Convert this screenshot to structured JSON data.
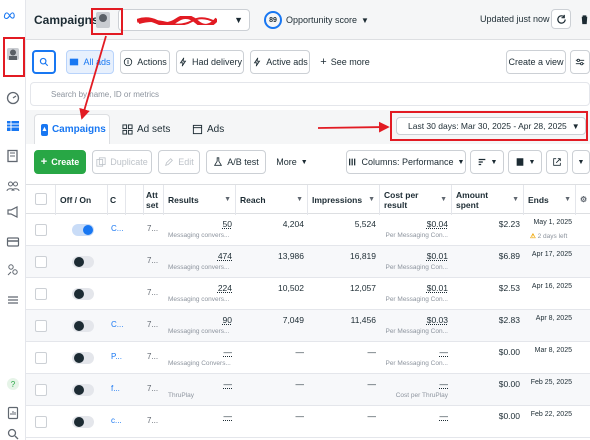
{
  "app": {
    "title": "Campaigns"
  },
  "colors": {
    "accent": "#1877f2",
    "create": "#28a745",
    "annotation": "#e21b23",
    "warning": "#f0a500"
  },
  "rail_icons": [
    "meta-logo-icon",
    "account-avatar-icon",
    "speedometer-icon",
    "table-grid-icon",
    "pages-icon",
    "people-icon",
    "megaphone-icon",
    "billing-card-icon",
    "audience-icon",
    "menu-icon",
    "help-icon",
    "report-icon",
    "search-icon"
  ],
  "header": {
    "opportunity_score": "89",
    "opportunity_label": "Opportunity score",
    "updated_text": "Updated just now"
  },
  "filters": {
    "all_ads": "All ads",
    "actions": "Actions",
    "had_delivery": "Had delivery",
    "active_ads": "Active ads",
    "see_more": "See more",
    "create_view": "Create a view"
  },
  "search": {
    "placeholder": "Search by name, ID or metrics"
  },
  "tabs": [
    {
      "label": "Campaigns"
    },
    {
      "label": "Ad sets"
    },
    {
      "label": "Ads"
    }
  ],
  "date_range": "Last 30 days: Mar 30, 2025 - Apr 28, 2025",
  "toolbar": {
    "create": "Create",
    "duplicate": "Duplicate",
    "edit": "Edit",
    "ab_test": "A/B test",
    "more": "More",
    "columns": "Columns: Performance"
  },
  "table": {
    "headers": {
      "onoff": "Off / On",
      "c": "C",
      "att1": "Att",
      "att2": "set",
      "results": "Results",
      "reach": "Reach",
      "impressions": "Impressions",
      "cost1": "Cost per",
      "cost2": "result",
      "amount": "Amount spent",
      "ends": "Ends"
    },
    "rows": [
      {
        "on": true,
        "name": "C...",
        "col3": "7...",
        "results": "50",
        "results_sub": "Messaging convers...",
        "reach": "4,204",
        "impressions": "5,524",
        "cost": "$0.04",
        "cost_sub": "Per Messaging Con...",
        "amount": "$2.23",
        "ends": "May 1, 2025",
        "ends_sub": "2 days left"
      },
      {
        "on": false,
        "name": "",
        "col3": "7...",
        "results": "474",
        "results_sub": "Messaging convers...",
        "reach": "13,986",
        "impressions": "16,819",
        "cost": "$0.01",
        "cost_sub": "Per Messaging Con...",
        "amount": "$6.89",
        "ends": "Apr 17, 2025",
        "ends_sub": ""
      },
      {
        "on": false,
        "name": "",
        "col3": "7...",
        "results": "224",
        "results_sub": "Messaging convers...",
        "reach": "10,502",
        "impressions": "12,057",
        "cost": "$0.01",
        "cost_sub": "Per Messaging Con...",
        "amount": "$2.53",
        "ends": "Apr 16, 2025",
        "ends_sub": ""
      },
      {
        "on": false,
        "name": "C...",
        "col3": "7...",
        "results": "90",
        "results_sub": "Messaging convers...",
        "reach": "7,049",
        "impressions": "11,456",
        "cost": "$0.03",
        "cost_sub": "Per Messaging Con...",
        "amount": "$2.83",
        "ends": "Apr 8, 2025",
        "ends_sub": ""
      },
      {
        "on": false,
        "name": "P...",
        "col3": "7...",
        "results": "—",
        "results_sub": "Messaging Convers...",
        "reach": "—",
        "impressions": "—",
        "cost": "—",
        "cost_sub": "Per Messaging Con...",
        "amount": "$0.00",
        "ends": "Mar 8, 2025",
        "ends_sub": ""
      },
      {
        "on": false,
        "name": "f...",
        "col3": "7...",
        "results": "—",
        "results_sub": "ThruPlay",
        "reach": "—",
        "impressions": "—",
        "cost": "—",
        "cost_sub": "Cost per ThruPlay",
        "amount": "$0.00",
        "ends": "Feb 25, 2025",
        "ends_sub": ""
      },
      {
        "on": false,
        "name": "c...",
        "col3": "7...",
        "results": "—",
        "results_sub": "",
        "reach": "—",
        "impressions": "—",
        "cost": "—",
        "cost_sub": "",
        "amount": "$0.00",
        "ends": "Feb 22, 2025",
        "ends_sub": ""
      }
    ]
  }
}
